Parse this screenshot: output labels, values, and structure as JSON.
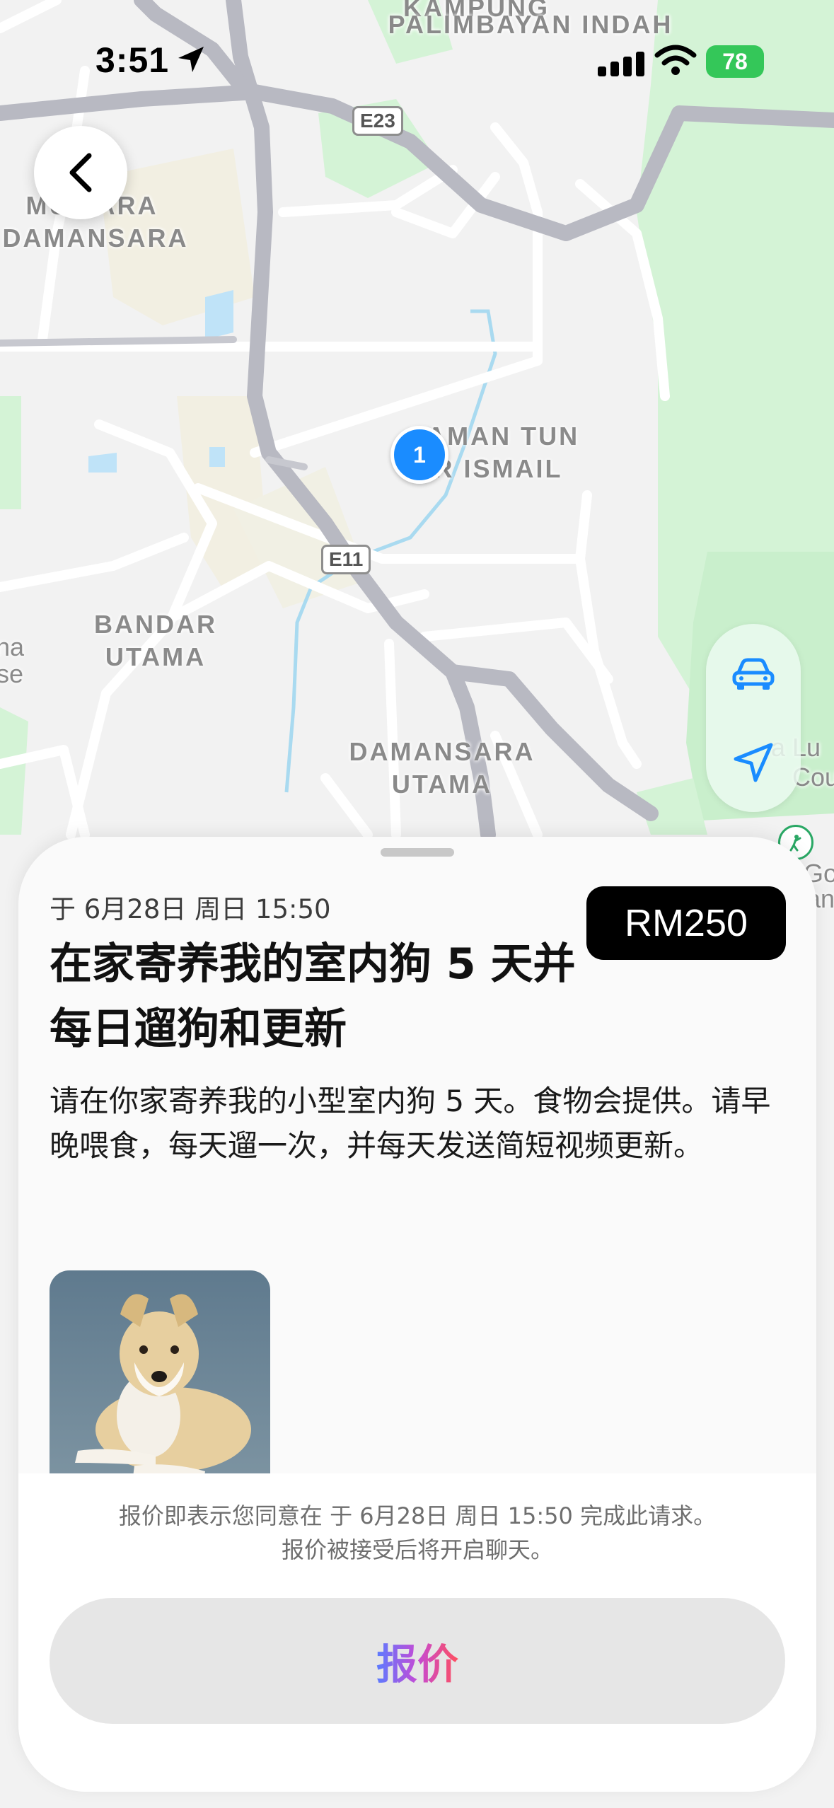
{
  "status_bar": {
    "time": "3:51",
    "battery": "78"
  },
  "map": {
    "labels": {
      "kampung_top": "KAMPUNG",
      "palimbayan": "PALIMBAYAN INDAH",
      "mutiara": "MUTIARA",
      "damansara_left": "DAMANSARA",
      "taman": "TAMAN TUN",
      "ismail": "DR ISMAIL",
      "bandar": "BANDAR",
      "utama": "UTAMA",
      "damansara": "DAMANSARA",
      "utama2": "UTAMA",
      "edge_left_1": "na",
      "edge_left_2": "se",
      "edge_right_1": "a Lu",
      "edge_right_2": "Cou",
      "edge_right_3": "Go",
      "edge_right_4": "an"
    },
    "shields": {
      "e23": "E23",
      "e11": "E11"
    },
    "pin_count": "1"
  },
  "task": {
    "date": "于 6月28日 周日 15:50",
    "price": "RM250",
    "title": "在家寄养我的室内狗 5 天并每日遛狗和更新",
    "description": "请在你家寄养我的小型室内狗 5 天。食物会提供。请早晚喂食，每天遛一次，并每天发送简短视频更新。"
  },
  "footer": {
    "notice_line1": "报价即表示您同意在 于 6月28日 周日 15:50 完成此请求。",
    "notice_line2": "报价被接受后将开启聊天。",
    "offer_label": "报价"
  },
  "colors": {
    "pin": "#1a8cff",
    "accent_blue": "#1a8cff",
    "price_bg": "#000000",
    "battery": "#34c759"
  },
  "icons": [
    "back-chevron-icon",
    "location-arrow-icon",
    "signal-icon",
    "wifi-icon",
    "car-icon",
    "navigation-arrow-icon",
    "golf-icon"
  ]
}
